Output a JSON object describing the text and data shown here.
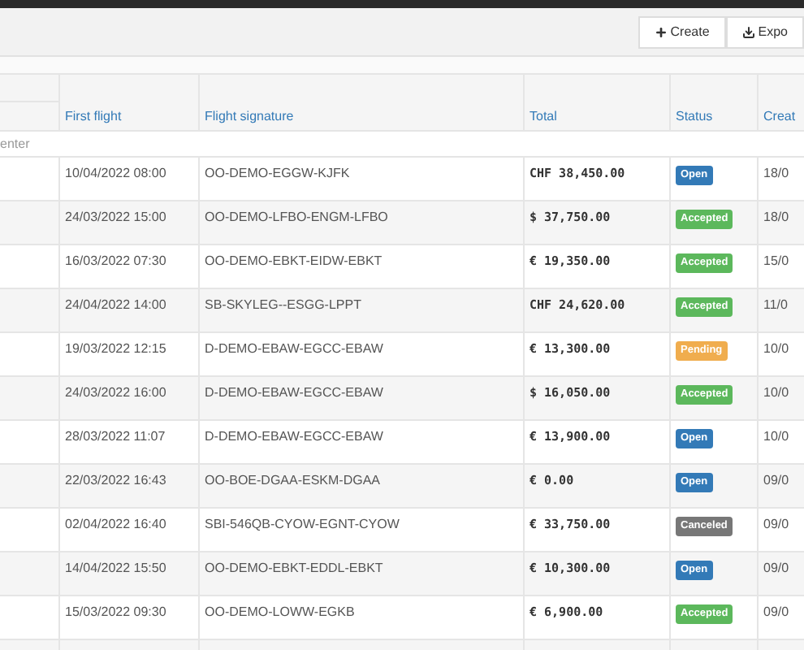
{
  "toolbar": {
    "buttons": [
      {
        "kind": "create",
        "label": "Create"
      },
      {
        "kind": "export",
        "label": "Expo"
      }
    ]
  },
  "table": {
    "columns": [
      "First flight",
      "Flight signature",
      "Total",
      "Status",
      "Creat"
    ],
    "group": "enter",
    "rows": [
      {
        "first_flight": "10/04/2022 08:00",
        "signature": "OO-DEMO-EGGW-KJFK",
        "total": "CHF 38,450.00",
        "status": {
          "kind": "open",
          "label": "Open"
        },
        "created": "18/0"
      },
      {
        "first_flight": "24/03/2022 15:00",
        "signature": "OO-DEMO-LFBO-ENGM-LFBO",
        "total": "$ 37,750.00",
        "status": {
          "kind": "accepted",
          "label": "Accepted"
        },
        "created": "18/0"
      },
      {
        "first_flight": "16/03/2022 07:30",
        "signature": "OO-DEMO-EBKT-EIDW-EBKT",
        "total": "€ 19,350.00",
        "status": {
          "kind": "accepted",
          "label": "Accepted"
        },
        "created": "15/0"
      },
      {
        "first_flight": "24/04/2022 14:00",
        "signature": "SB-SKYLEG--ESGG-LPPT",
        "total": "CHF 24,620.00",
        "status": {
          "kind": "accepted",
          "label": "Accepted"
        },
        "created": "11/0"
      },
      {
        "first_flight": "19/03/2022 12:15",
        "signature": "D-DEMO-EBAW-EGCC-EBAW",
        "total": "€ 13,300.00",
        "status": {
          "kind": "pending",
          "label": "Pending"
        },
        "created": "10/0"
      },
      {
        "first_flight": "24/03/2022 16:00",
        "signature": "D-DEMO-EBAW-EGCC-EBAW",
        "total": "$ 16,050.00",
        "status": {
          "kind": "accepted",
          "label": "Accepted"
        },
        "created": "10/0"
      },
      {
        "first_flight": "28/03/2022 11:07",
        "signature": "D-DEMO-EBAW-EGCC-EBAW",
        "total": "€ 13,900.00",
        "status": {
          "kind": "open",
          "label": "Open"
        },
        "created": "10/0"
      },
      {
        "first_flight": "22/03/2022 16:43",
        "signature": "OO-BOE-DGAA-ESKM-DGAA",
        "total": "€ 0.00",
        "status": {
          "kind": "open",
          "label": "Open"
        },
        "created": "09/0"
      },
      {
        "first_flight": "02/04/2022 16:40",
        "signature": "SBI-546QB-CYOW-EGNT-CYOW",
        "total": "€ 33,750.00",
        "status": {
          "kind": "canceled",
          "label": "Canceled"
        },
        "created": "09/0"
      },
      {
        "first_flight": "14/04/2022 15:50",
        "signature": "OO-DEMO-EBKT-EDDL-EBKT",
        "total": "€ 10,300.00",
        "status": {
          "kind": "open",
          "label": "Open"
        },
        "created": "09/0"
      },
      {
        "first_flight": "15/03/2022 09:30",
        "signature": "OO-DEMO-LOWW-EGKB",
        "total": "€ 6,900.00",
        "status": {
          "kind": "accepted",
          "label": "Accepted"
        },
        "created": "09/0"
      }
    ]
  }
}
